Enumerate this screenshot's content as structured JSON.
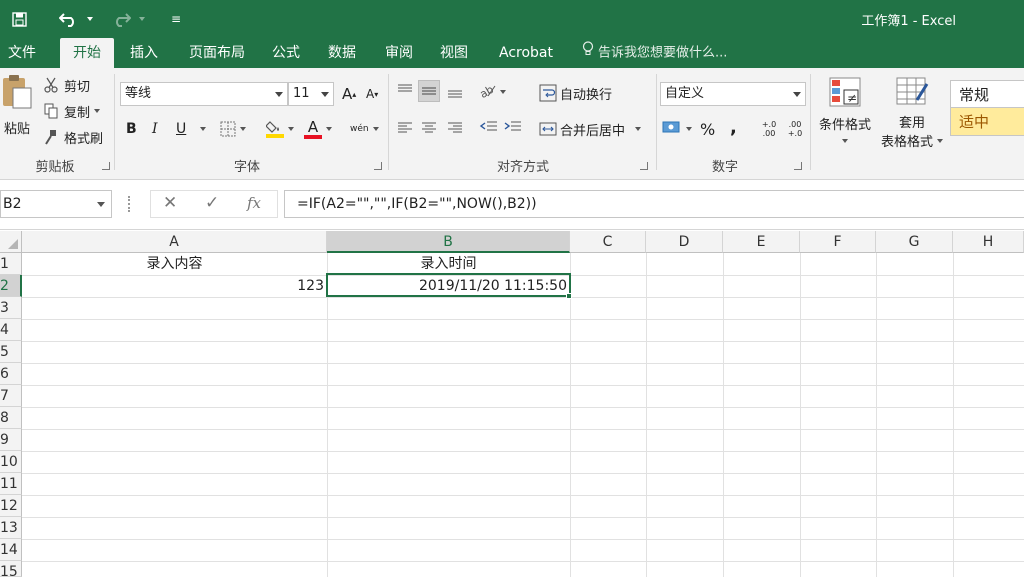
{
  "window": {
    "title": "工作簿1 - Excel"
  },
  "quick_access": {
    "customize_symbol": "≡"
  },
  "menu": {
    "tabs": [
      {
        "label": "文件",
        "active": false
      },
      {
        "label": "开始",
        "active": true
      },
      {
        "label": "插入",
        "active": false
      },
      {
        "label": "页面布局",
        "active": false
      },
      {
        "label": "公式",
        "active": false
      },
      {
        "label": "数据",
        "active": false
      },
      {
        "label": "审阅",
        "active": false
      },
      {
        "label": "视图",
        "active": false
      },
      {
        "label": "Acrobat",
        "active": false
      }
    ],
    "tell_me": "告诉我您想要做什么..."
  },
  "ribbon": {
    "clipboard": {
      "paste": "粘贴",
      "cut": "剪切",
      "copy": "复制",
      "format_painter": "格式刷",
      "group_label": "剪贴板"
    },
    "font": {
      "font_name": "等线",
      "font_size": "11",
      "bold": "B",
      "italic": "I",
      "underline": "U",
      "grow": "A",
      "shrink": "A",
      "font_color_letter": "A",
      "phonetic": "wén",
      "group_label": "字体"
    },
    "alignment": {
      "wrap_text": "自动换行",
      "merge_center": "合并后居中",
      "group_label": "对齐方式"
    },
    "number": {
      "format": "自定义",
      "percent": "%",
      "comma": ",",
      "inc_decimal": "+.0 .00",
      "dec_decimal": ".00 +.0",
      "group_label": "数字"
    },
    "styles": {
      "conditional_format": "条件格式",
      "format_table_line1": "套用",
      "format_table_line2": "表格格式",
      "style_normal": "常规",
      "style_neutral": "适中"
    },
    "colors": {
      "fill_color": "#ffd800",
      "font_color": "#e81123",
      "neutral_bg": "#ffeb9c",
      "neutral_text": "#9c5700"
    }
  },
  "formula_bar": {
    "name_box": "B2",
    "cancel_symbol": "✕",
    "enter_symbol": "✓",
    "fx_symbol": "fx",
    "formula": "=IF(A2=\"\",\"\",IF(B2=\"\",NOW(),B2))"
  },
  "sheet": {
    "columns": [
      "A",
      "B",
      "C",
      "D",
      "E",
      "F",
      "G",
      "H"
    ],
    "rows": [
      "1",
      "2",
      "3",
      "4",
      "5",
      "6",
      "7",
      "8",
      "9",
      "10",
      "11",
      "12",
      "13",
      "14",
      "15"
    ],
    "cells": {
      "A1": "录入内容",
      "B1": "录入时间",
      "A2": "123",
      "B2": "2019/11/20 11:15:50"
    },
    "selected_cell": "B2",
    "accent_color": "#217346"
  }
}
